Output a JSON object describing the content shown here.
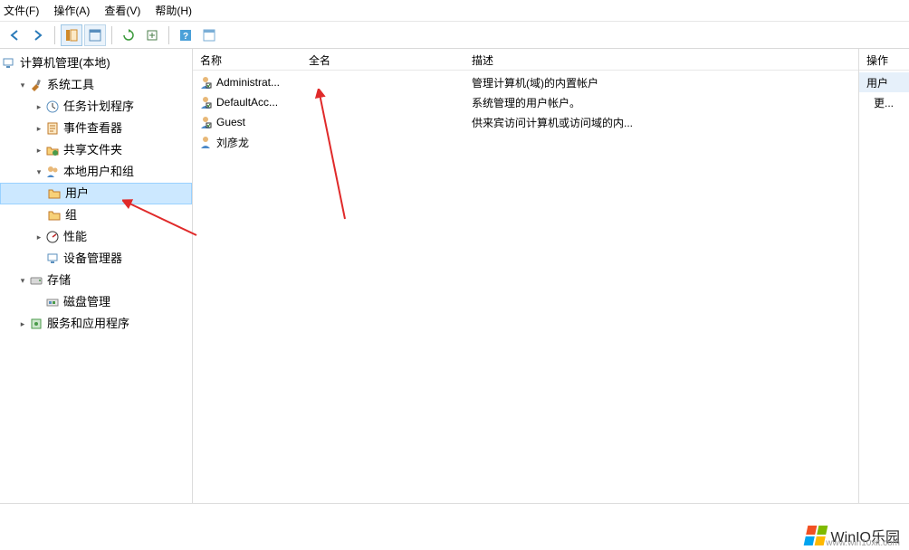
{
  "menu": {
    "file": "文件(F)",
    "action": "操作(A)",
    "view": "查看(V)",
    "help": "帮助(H)"
  },
  "tree": {
    "root": "计算机管理(本地)",
    "system_tools": "系统工具",
    "task_scheduler": "任务计划程序",
    "event_viewer": "事件查看器",
    "shared_folders": "共享文件夹",
    "local_users_groups": "本地用户和组",
    "users": "用户",
    "groups": "组",
    "performance": "性能",
    "device_manager": "设备管理器",
    "storage": "存储",
    "disk_management": "磁盘管理",
    "services_apps": "服务和应用程序"
  },
  "columns": {
    "name": "名称",
    "fullname": "全名",
    "description": "描述"
  },
  "users": [
    {
      "name": "Administrat...",
      "fullname": "",
      "description": "管理计算机(域)的内置帐户"
    },
    {
      "name": "DefaultAcc...",
      "fullname": "",
      "description": "系统管理的用户帐户。"
    },
    {
      "name": "Guest",
      "fullname": "",
      "description": "供来宾访问计算机或访问域的内..."
    },
    {
      "name": "刘彦龙",
      "fullname": "",
      "description": ""
    }
  ],
  "actions": {
    "header": "操作",
    "section": "用户",
    "more": "更..."
  },
  "brand": {
    "name": "WinIO乐园",
    "url": "www.win10xit.com"
  }
}
